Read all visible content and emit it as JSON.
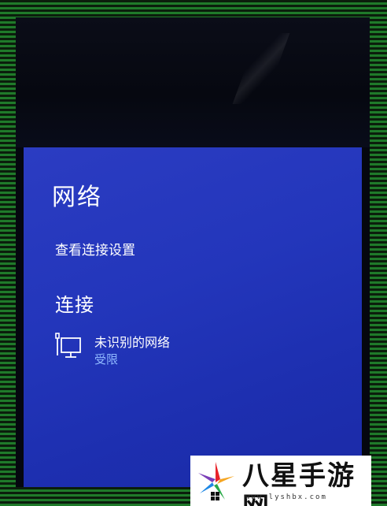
{
  "network_panel": {
    "title": "网络",
    "settings_link": "查看连接设置",
    "section_title": "连接",
    "connection": {
      "name": "未识别的网络",
      "status": "受限",
      "icon": "ethernet-icon"
    }
  },
  "watermark": {
    "text": "八星手游网",
    "url": "www.lyshbx.com"
  },
  "colors": {
    "panel_blue": "#2336bb",
    "status_blue": "#8fb8ff",
    "text": "#ffffff"
  }
}
